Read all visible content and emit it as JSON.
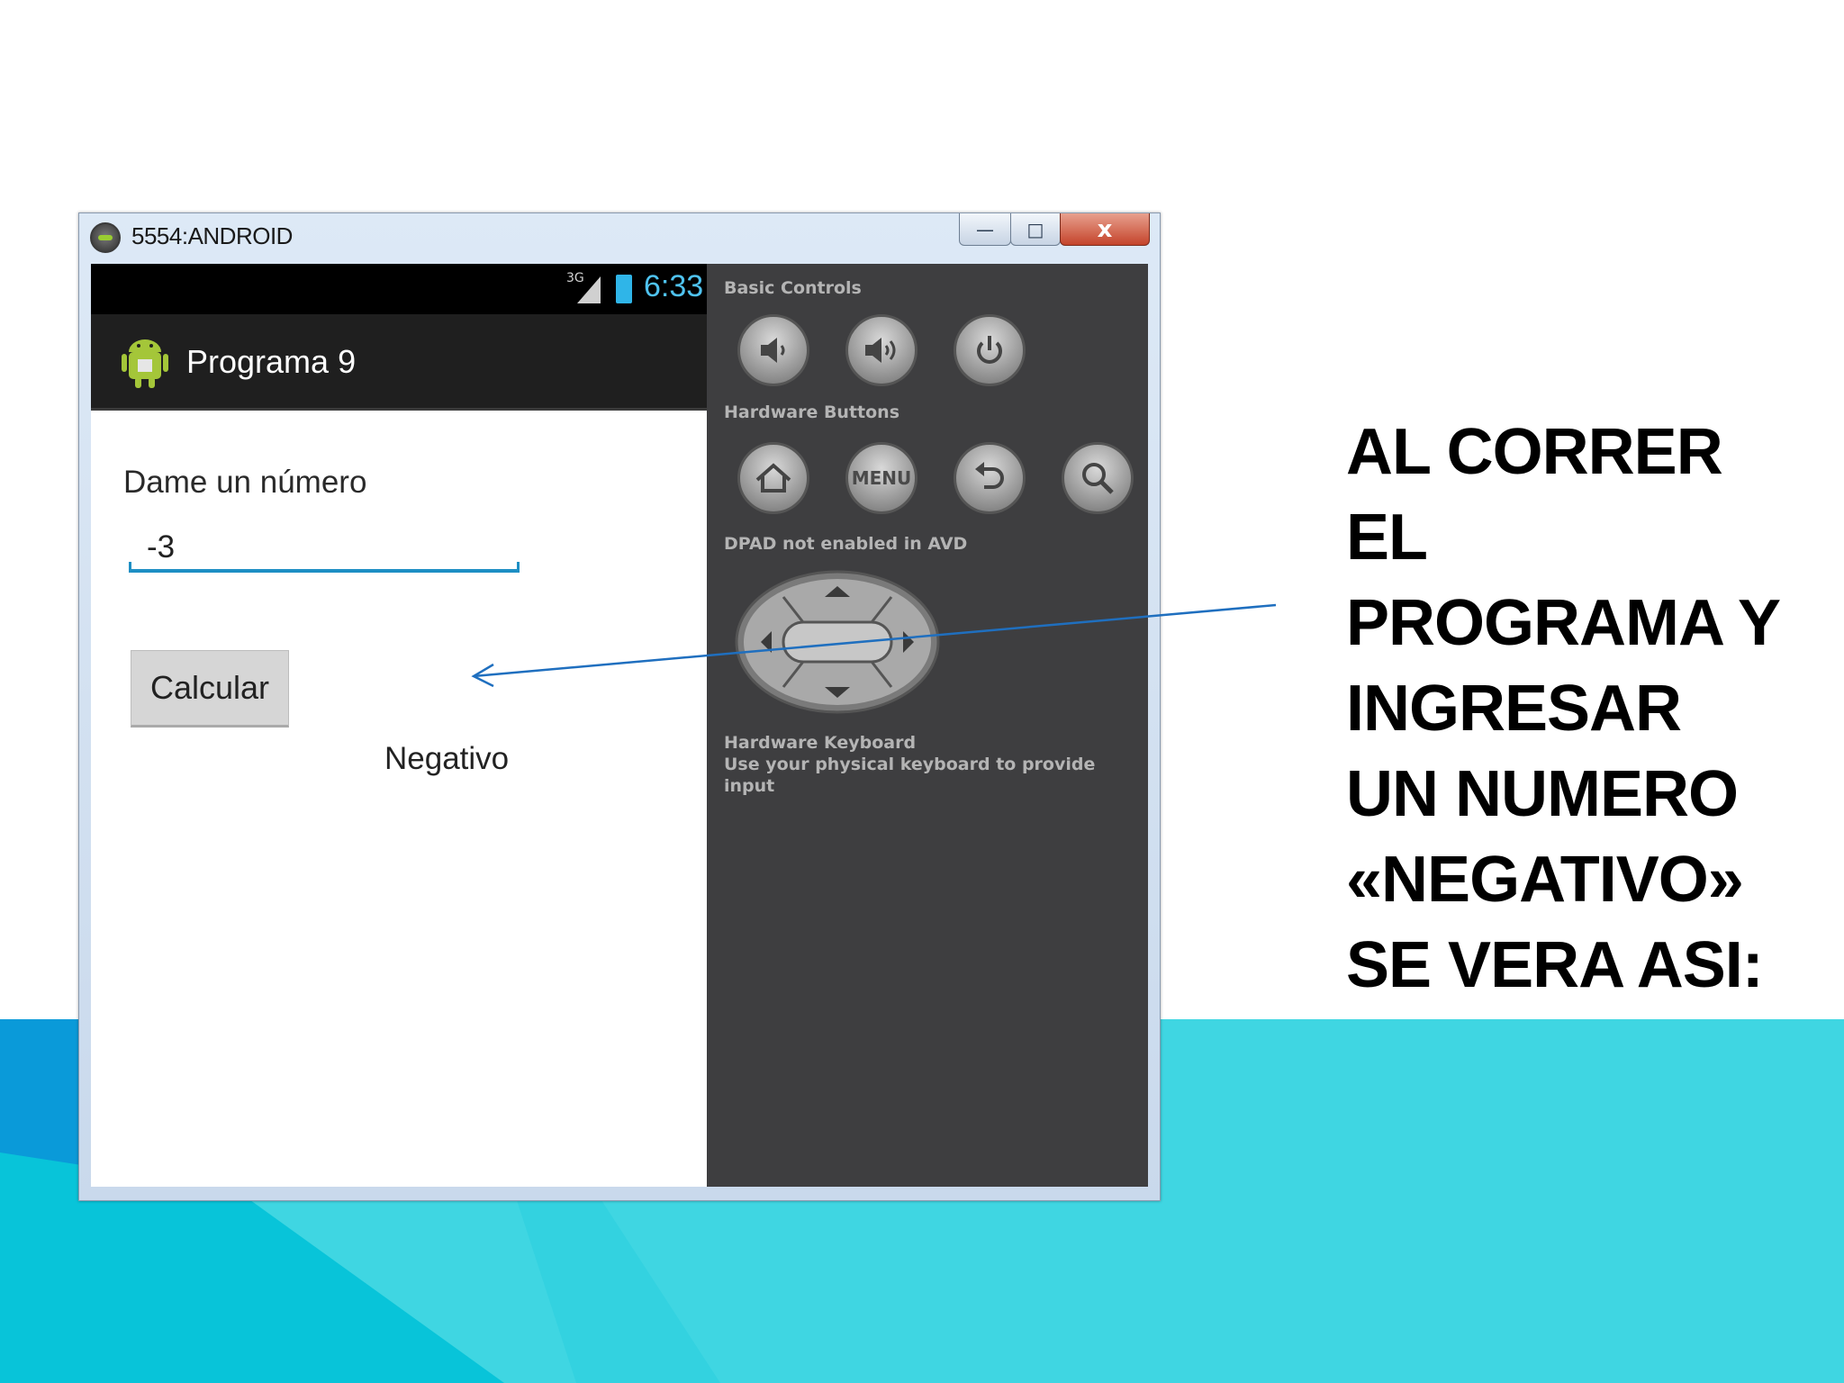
{
  "window": {
    "title": "5554:ANDROID",
    "minimize_glyph": "—",
    "maximize_glyph": "□",
    "close_glyph": "x"
  },
  "status_bar": {
    "network": "3G",
    "time": "6:33"
  },
  "app": {
    "title": "Programa 9",
    "label": "Dame un número",
    "input_value": "-3",
    "button_label": "Calcular",
    "result": "Negativo"
  },
  "controls": {
    "basic_controls": "Basic Controls",
    "hardware_buttons": "Hardware Buttons",
    "menu_label": "MENU",
    "dpad": "DPAD not enabled in AVD",
    "keyboard_title": "Hardware Keyboard",
    "keyboard_hint": "Use your physical keyboard to provide input"
  },
  "heading": {
    "lines": [
      "AL CORRER",
      "EL",
      "PROGRAMA Y",
      "INGRESAR",
      "UN NUMERO",
      "«NEGATIVO»",
      "SE VERA ASI:"
    ]
  },
  "colors": {
    "background_blue": "#0a9ad9",
    "background_cyan": "#3fd6e2",
    "arrow": "#1f6fbf",
    "clock": "#4fc3f0",
    "input_underline": "#1e8fc4"
  }
}
